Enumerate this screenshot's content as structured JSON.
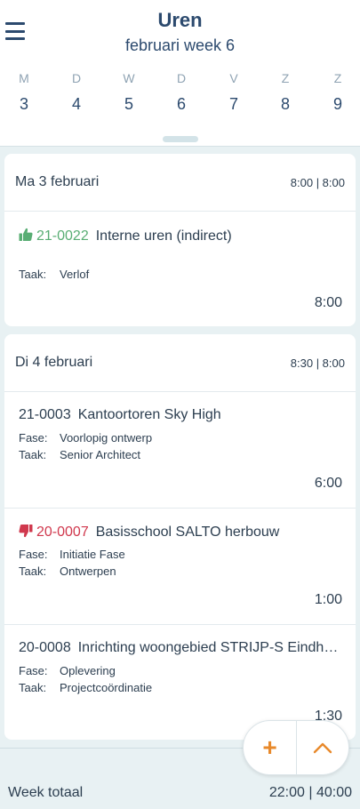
{
  "header": {
    "title": "Uren",
    "subtitle": "februari week 6",
    "menu_icon": "hamburger-menu-icon",
    "days": [
      {
        "letter": "M",
        "num": "3"
      },
      {
        "letter": "D",
        "num": "4"
      },
      {
        "letter": "W",
        "num": "5"
      },
      {
        "letter": "D",
        "num": "6"
      },
      {
        "letter": "V",
        "num": "7"
      },
      {
        "letter": "Z",
        "num": "8"
      },
      {
        "letter": "Z",
        "num": "9"
      }
    ]
  },
  "days": [
    {
      "title": "Ma 3 februari",
      "totals": "8:00 | 8:00",
      "entries": [
        {
          "status_icon": "thumbs-up-icon",
          "code": "21-0022",
          "name": "Interne uren (indirect)",
          "fase_label": "",
          "fase": "",
          "taak_label": "Taak:",
          "taak": "Verlof",
          "hours": "8:00"
        }
      ]
    },
    {
      "title": "Di 4 februari",
      "totals": "8:30 | 8:00",
      "entries": [
        {
          "code": "21-0003",
          "name": "Kantoortoren Sky High",
          "fase_label": "Fase:",
          "fase": "Voorlopig ontwerp",
          "taak_label": "Taak:",
          "taak": "Senior Architect",
          "hours": "6:00"
        },
        {
          "status_icon": "thumbs-down-icon",
          "code": "20-0007",
          "name": "Basisschool SALTO herbouw",
          "fase_label": "Fase:",
          "fase": "Initiatie Fase",
          "taak_label": "Taak:",
          "taak": "Ontwerpen",
          "hours": "1:00"
        },
        {
          "code": "20-0008",
          "name": "Inrichting woongebied STRIJP-S Eindhoven",
          "fase_label": "Fase:",
          "fase": "Oplevering",
          "taak_label": "Taak:",
          "taak": "Projectcoördinatie",
          "hours": "1:30"
        }
      ]
    }
  ],
  "footer": {
    "label": "Week totaal",
    "value": "22:00 | 40:00"
  },
  "fab": {
    "add": "+",
    "add_icon": "plus-icon",
    "up_icon": "chevron-up-icon"
  },
  "colors": {
    "primary": "#2c4a6e",
    "approved": "#58ad73",
    "rejected": "#d0384d",
    "accent": "#e8892b",
    "background": "#e8f1f3"
  }
}
